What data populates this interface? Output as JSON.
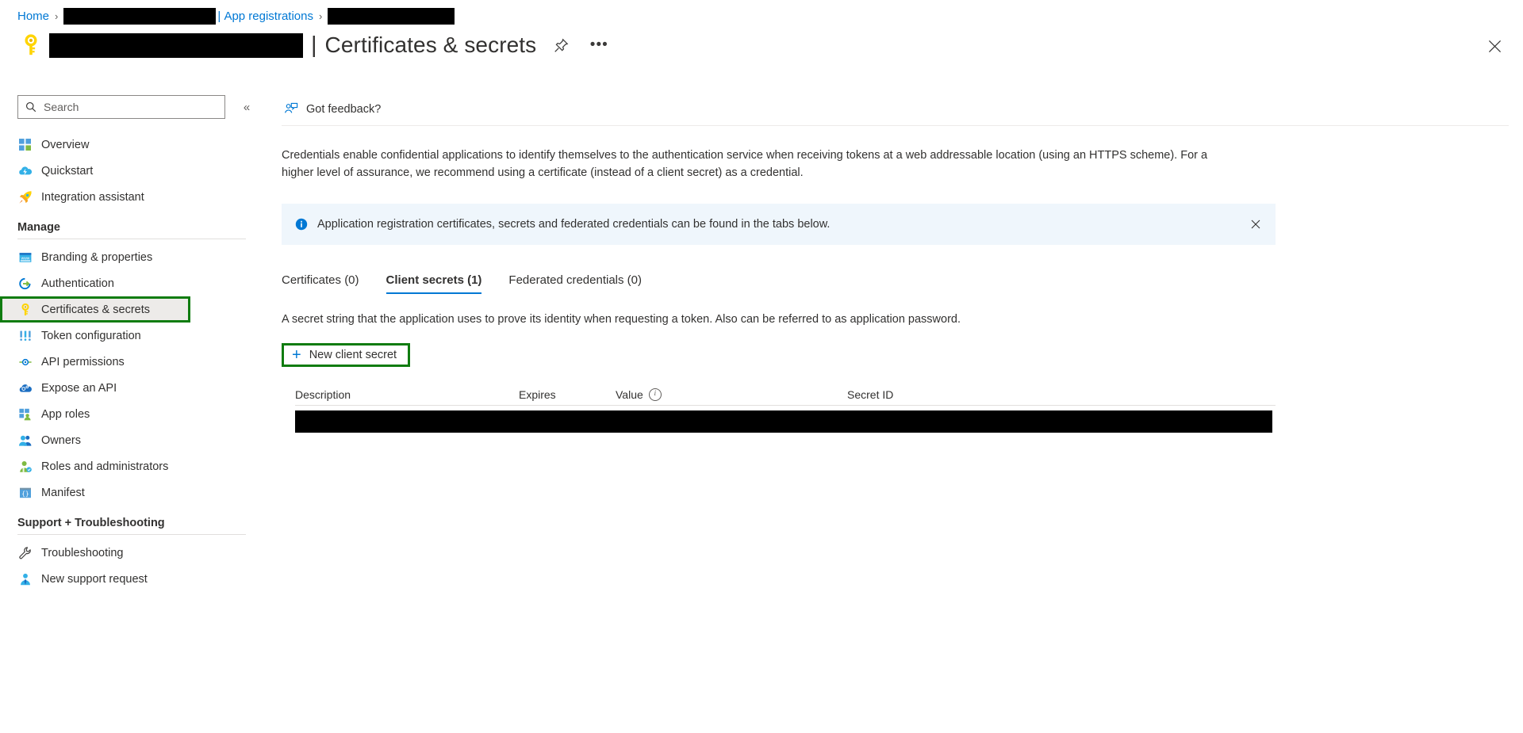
{
  "breadcrumb": {
    "home": "Home",
    "sep": "›",
    "app_registrations": "App registrations",
    "pipe": "|",
    "redacted_1": "",
    "redacted_2": ""
  },
  "header": {
    "app_name_redacted": "",
    "separator": "|",
    "page_title": "Certificates & secrets",
    "pin_icon": "pin-icon",
    "more_icon": "ellipsis-icon",
    "close_icon": "close-icon"
  },
  "sidebar": {
    "search": {
      "placeholder": "Search",
      "value": "",
      "icon": "search-icon"
    },
    "collapse_label": "«",
    "items": [
      {
        "label": "Overview",
        "icon": "overview-grid-icon"
      },
      {
        "label": "Quickstart",
        "icon": "quickstart-cloud-icon"
      },
      {
        "label": "Integration assistant",
        "icon": "rocket-icon"
      }
    ],
    "manage_group": {
      "title": "Manage",
      "items": [
        {
          "label": "Branding & properties",
          "icon": "branding-window-icon"
        },
        {
          "label": "Authentication",
          "icon": "authentication-arrow-icon"
        },
        {
          "label": "Certificates & secrets",
          "icon": "key-icon",
          "selected": true,
          "highlighted": true
        },
        {
          "label": "Token configuration",
          "icon": "token-bars-icon"
        },
        {
          "label": "API permissions",
          "icon": "api-permissions-icon"
        },
        {
          "label": "Expose an API",
          "icon": "expose-api-cloud-icon"
        },
        {
          "label": "App roles",
          "icon": "app-roles-icon"
        },
        {
          "label": "Owners",
          "icon": "owners-people-icon"
        },
        {
          "label": "Roles and administrators",
          "icon": "roles-admin-icon"
        },
        {
          "label": "Manifest",
          "icon": "manifest-braces-icon"
        }
      ]
    },
    "support_group": {
      "title": "Support + Troubleshooting",
      "items": [
        {
          "label": "Troubleshooting",
          "icon": "wrench-icon"
        },
        {
          "label": "New support request",
          "icon": "support-person-icon"
        }
      ]
    }
  },
  "main": {
    "feedback": {
      "label": "Got feedback?",
      "icon": "feedback-person-icon"
    },
    "description": "Credentials enable confidential applications to identify themselves to the authentication service when receiving tokens at a web addressable location (using an HTTPS scheme). For a higher level of assurance, we recommend using a certificate (instead of a client secret) as a credential.",
    "info_banner": {
      "icon": "info-icon",
      "text": "Application registration certificates, secrets and federated credentials can be found in the tabs below.",
      "close_icon": "close-icon"
    },
    "tabs": [
      {
        "label": "Certificates (0)",
        "active": false
      },
      {
        "label": "Client secrets (1)",
        "active": true
      },
      {
        "label": "Federated credentials (0)",
        "active": false
      }
    ],
    "sub_description": "A secret string that the application uses to prove its identity when requesting a token. Also can be referred to as application password.",
    "new_secret_button": {
      "label": "New client secret",
      "plus": "+"
    },
    "table": {
      "columns": [
        "Description",
        "Expires",
        "Value",
        "Secret ID"
      ],
      "value_info_icon": "i",
      "rows": [
        {
          "description": "",
          "expires": "",
          "value": "",
          "secret_id": "",
          "redacted": true
        }
      ]
    }
  },
  "colors": {
    "accent": "#0078d4",
    "highlight_green": "#107c10",
    "banner_bg": "#eff6fc",
    "selected_bg": "#edebe9",
    "redaction": "#000000"
  }
}
